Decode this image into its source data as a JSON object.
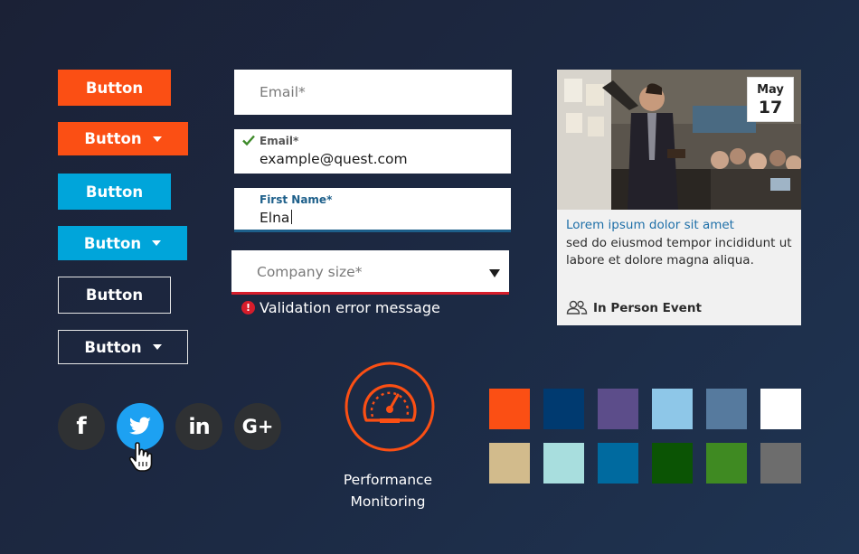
{
  "buttons": [
    {
      "label": "Button",
      "style": "orange",
      "caret": false
    },
    {
      "label": "Button",
      "style": "orange",
      "caret": true
    },
    {
      "label": "Button",
      "style": "blue",
      "caret": false
    },
    {
      "label": "Button",
      "style": "blue",
      "caret": true
    },
    {
      "label": "Button",
      "style": "outline",
      "caret": false
    },
    {
      "label": "Button",
      "style": "outline",
      "caret": true
    }
  ],
  "form": {
    "email_empty": {
      "placeholder": "Email*"
    },
    "email_valid": {
      "label": "Email*",
      "value": "example@quest.com",
      "state": "valid"
    },
    "first_name": {
      "label": "First Name*",
      "value": "Elna",
      "state": "focused"
    },
    "company_size": {
      "placeholder": "Company size*",
      "state": "error"
    },
    "validation_error": "Validation error message"
  },
  "event_card": {
    "date_month": "May",
    "date_day": "17",
    "title": "Lorem ipsum dolor sit amet",
    "description": "sed do eiusmod tempor incididunt ut labore et dolore magna aliqua.",
    "event_type": "In Person Event",
    "event_type_icon": "people-icon"
  },
  "social_icons": [
    {
      "name": "facebook-icon",
      "glyph": "f",
      "active": false
    },
    {
      "name": "twitter-icon",
      "glyph": "bird",
      "active": true
    },
    {
      "name": "linkedin-icon",
      "glyph": "in",
      "active": false
    },
    {
      "name": "google-plus-icon",
      "glyph": "G+",
      "active": false
    }
  ],
  "feature": {
    "icon": "speedometer-icon",
    "line1": "Performance",
    "line2": "Monitoring"
  },
  "colors": {
    "orange": "#fb4f14",
    "blue": "#00a5da",
    "twitter_active": "#1da1f2",
    "error_red": "#d61d2b",
    "focus_blue": "#1d5f8a",
    "valid_green": "#3e8a2a",
    "link_blue": "#1e6fa8"
  },
  "palette": [
    "#fb4f14",
    "#003a70",
    "#5c4d8a",
    "#8ec7e8",
    "#567a9e",
    "#ffffff",
    "#d2bb8c",
    "#a8dede",
    "#006a9f",
    "#0b5404",
    "#3f8a22",
    "#6d6d6d"
  ]
}
